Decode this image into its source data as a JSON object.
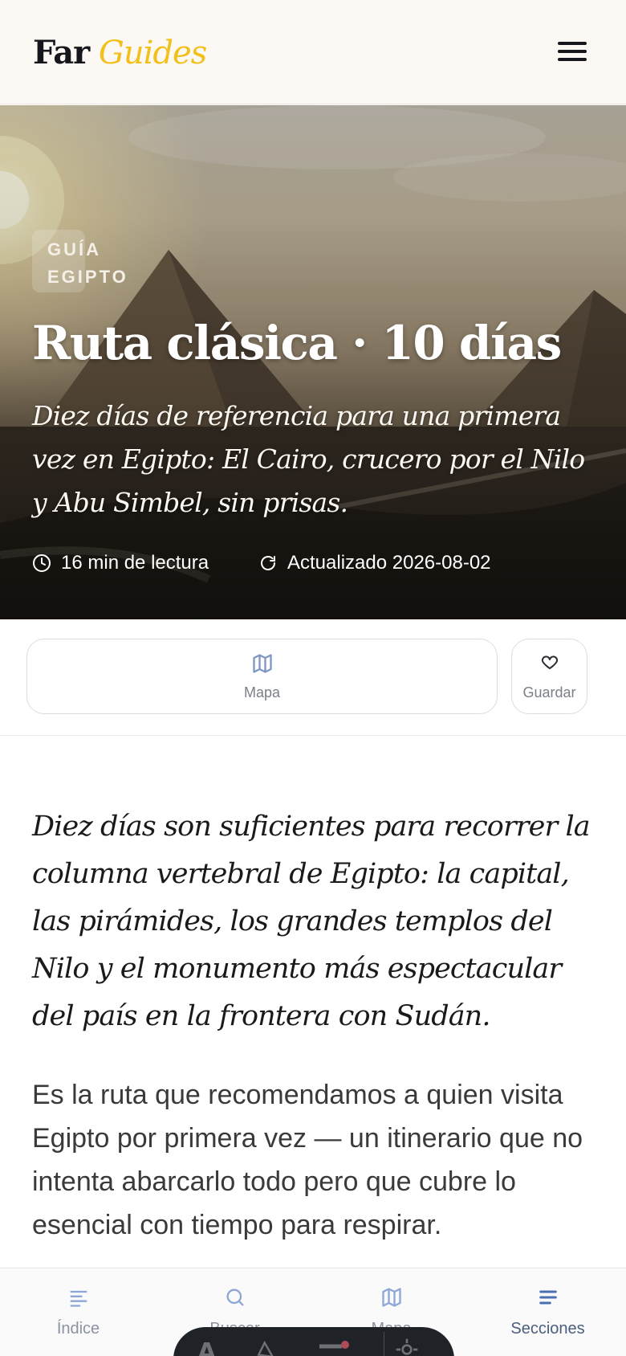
{
  "header": {
    "logo_part1": "Far",
    "logo_part2": "Guides",
    "menu_icon": "hamburger-menu-icon"
  },
  "hero": {
    "tag": "Guía Egipto",
    "title": "Ruta clásica · 10 días",
    "subtitle": "Diez días de referencia para una primera vez en Egipto: El Cairo, crucero por el Nilo y Abu Simbel, sin prisas.",
    "read_time": "16 min de lectura",
    "updated": "Actualizado 2026-08-02"
  },
  "actions": {
    "map_label": "Mapa",
    "save_label": "Guardar"
  },
  "article": {
    "lead": "Diez días son suficientes para recorrer la columna vertebral de Egipto: la capital, las pirámides, los grandes templos del Nilo y el monumento más espectacular del país en la frontera con Sudán.",
    "body": "Es la ruta que recomendamos a quien visita Egipto por primera vez — un itinerario que no intenta abarcarlo todo pero que cubre lo esencial con tiempo para respirar."
  },
  "bottom_nav": {
    "items": [
      {
        "label": "Índice",
        "icon": "list-icon"
      },
      {
        "label": "Buscar",
        "icon": "search-icon"
      },
      {
        "label": "Mapa",
        "icon": "map-icon"
      },
      {
        "label": "Secciones",
        "icon": "sections-icon"
      }
    ]
  },
  "floating_toolbar": {
    "items": [
      "A"
    ]
  },
  "colors": {
    "brand_accent": "#f2bf1b",
    "ink": "#15171c",
    "nav_active": "#4b5e7e"
  }
}
